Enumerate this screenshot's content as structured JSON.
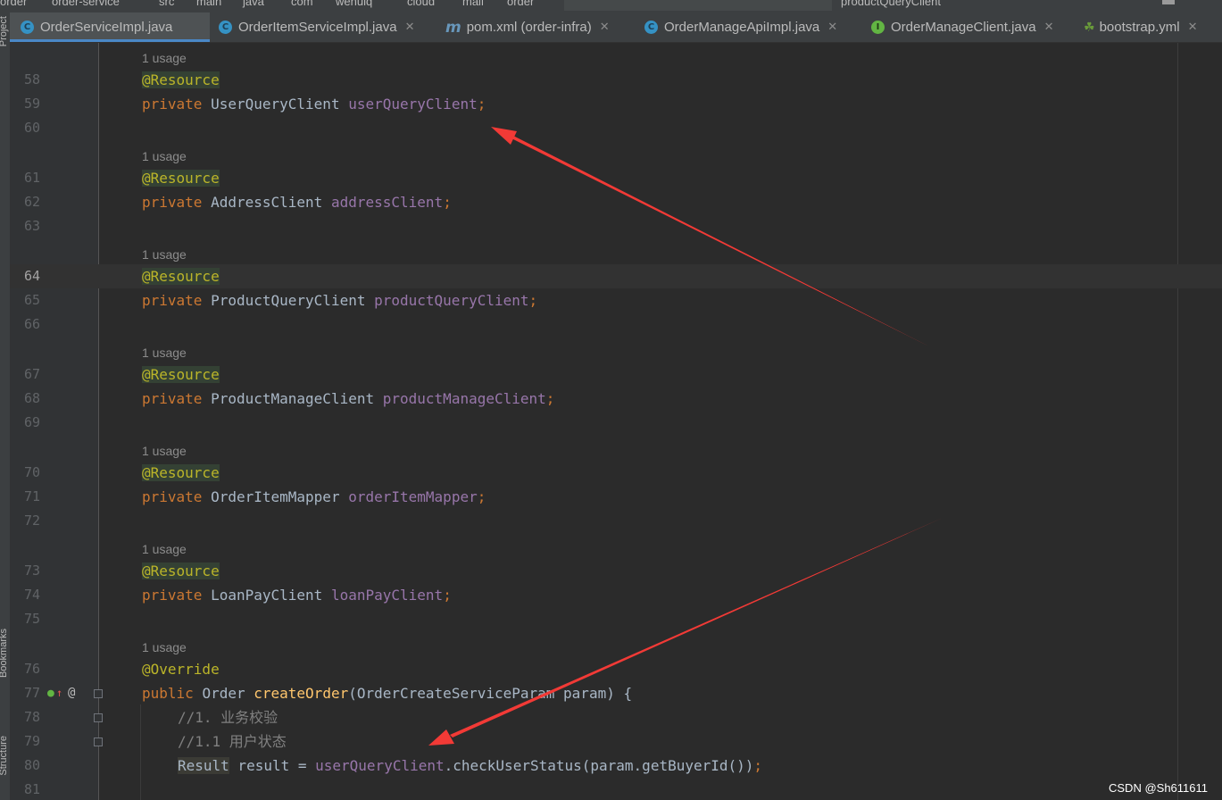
{
  "breadcrumb": {
    "items": [
      "order",
      "order-service",
      "src",
      "main",
      "java",
      "com",
      "wehuiq",
      "cloud",
      "mall",
      "order"
    ],
    "right_text": "productQueryClient"
  },
  "tool_windows": [
    "Project",
    "Bookmarks",
    "Structure"
  ],
  "tabs": [
    {
      "label": "OrderServiceImpl.java",
      "icon": "class-icon",
      "active": true
    },
    {
      "label": "OrderItemServiceImpl.java",
      "icon": "class-icon",
      "active": false
    },
    {
      "label": "pom.xml (order-infra)",
      "icon": "maven-icon",
      "active": false
    },
    {
      "label": "OrderManageApiImpl.java",
      "icon": "class-icon",
      "active": false
    },
    {
      "label": "OrderManageClient.java",
      "icon": "interface-icon",
      "active": false
    },
    {
      "label": "bootstrap.yml",
      "icon": "spring-leaf-icon",
      "active": false
    }
  ],
  "editor": {
    "usage_hint": "1 usage",
    "lines": [
      {
        "num": "58",
        "annotation": "@Resource"
      },
      {
        "num": "59",
        "keyword": "private",
        "type": "UserQueryClient",
        "field": "userQueryClient",
        "punct": ";"
      },
      {
        "num": "60"
      },
      {
        "num": "61",
        "annotation": "@Resource"
      },
      {
        "num": "62",
        "keyword": "private",
        "type": "AddressClient",
        "field": "addressClient",
        "punct": ";"
      },
      {
        "num": "63"
      },
      {
        "num": "64",
        "annotation": "@Resource"
      },
      {
        "num": "65",
        "keyword": "private",
        "type": "ProductQueryClient",
        "field": "productQueryClient",
        "punct": ";"
      },
      {
        "num": "66"
      },
      {
        "num": "67",
        "annotation": "@Resource"
      },
      {
        "num": "68",
        "keyword": "private",
        "type": "ProductManageClient",
        "field": "productManageClient",
        "punct": ";"
      },
      {
        "num": "69"
      },
      {
        "num": "70",
        "annotation": "@Resource"
      },
      {
        "num": "71",
        "keyword": "private",
        "type": "OrderItemMapper",
        "field": "orderItemMapper",
        "punct": ";"
      },
      {
        "num": "72"
      },
      {
        "num": "73",
        "annotation": "@Resource"
      },
      {
        "num": "74",
        "keyword": "private",
        "type": "LoanPayClient",
        "field": "loanPayClient",
        "punct": ";"
      },
      {
        "num": "75"
      },
      {
        "num": "76",
        "annotation": "@Override"
      },
      {
        "num": "77",
        "keyword": "public",
        "type": "Order",
        "method": "createOrder",
        "params_open": "(OrderCreateServiceParam param) {"
      },
      {
        "num": "78",
        "comment": "//1. 业务校验"
      },
      {
        "num": "79",
        "comment": "//1.1 用户状态"
      },
      {
        "num": "80",
        "result_type": "Result",
        "var": " result = ",
        "field": "userQueryClient",
        "call": ".checkUserStatus(param.getBuyerId())",
        "punct": ";"
      },
      {
        "num": "81"
      }
    ]
  },
  "watermark": "CSDN @Sh611611",
  "colors": {
    "arrow": "#f23a36",
    "annotation": "#bbb529",
    "keyword": "#cc7832",
    "field": "#9876aa",
    "method": "#ffc66d",
    "active_tab_underline": "#4a88c7"
  }
}
